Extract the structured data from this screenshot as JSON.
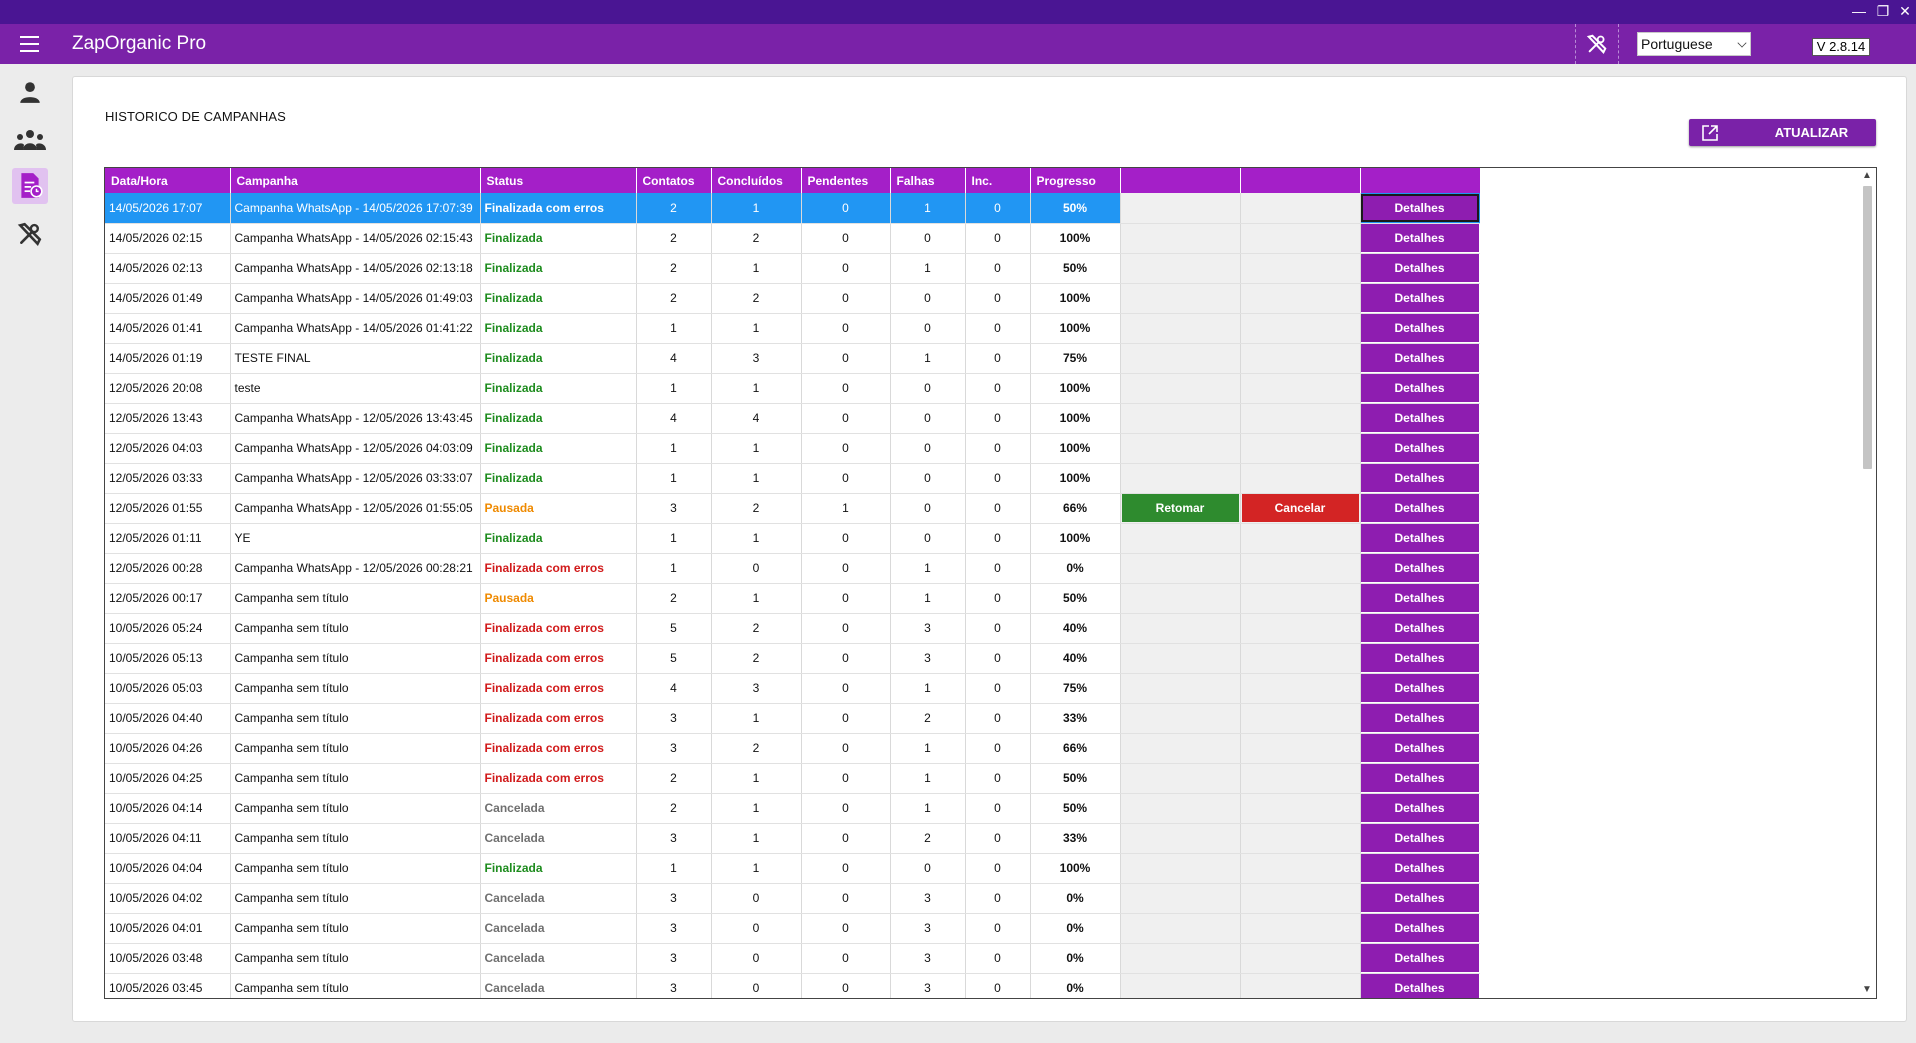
{
  "app": {
    "title": "ZapOrganic Pro",
    "version": "V 2.8.14"
  },
  "window_controls": {
    "minimize": "—",
    "restore": "❐",
    "close": "✕"
  },
  "header": {
    "language": "Portuguese"
  },
  "page": {
    "title": "HISTORICO DE CAMPANHAS",
    "refresh_label": "ATUALIZAR"
  },
  "table": {
    "columns": [
      "Data/Hora",
      "Campanha",
      "Status",
      "Contatos",
      "Concluídos",
      "Pendentes",
      "Falhas",
      "Inc.",
      "Progresso",
      "",
      "",
      ""
    ],
    "details_label": "Detalhes",
    "resume_label": "Retomar",
    "cancel_label": "Cancelar",
    "status_colors": {
      "Finalizada": "#1e8c1e",
      "Finalizada com erros": "#d11a1a",
      "Pausada": "#ef8a00",
      "Cancelada": "#707070"
    },
    "selected_row_color": "#2196f3",
    "rows": [
      {
        "datetime": "14/05/2026 17:07",
        "campaign": "Campanha WhatsApp - 14/05/2026 17:07:39",
        "status": "Finalizada com erros",
        "contacts": "2",
        "done": "1",
        "pending": "0",
        "failed": "1",
        "inc": "0",
        "progress": "50%",
        "selected": true
      },
      {
        "datetime": "14/05/2026 02:15",
        "campaign": "Campanha WhatsApp - 14/05/2026 02:15:43",
        "status": "Finalizada",
        "contacts": "2",
        "done": "2",
        "pending": "0",
        "failed": "0",
        "inc": "0",
        "progress": "100%"
      },
      {
        "datetime": "14/05/2026 02:13",
        "campaign": "Campanha WhatsApp - 14/05/2026 02:13:18",
        "status": "Finalizada",
        "contacts": "2",
        "done": "1",
        "pending": "0",
        "failed": "1",
        "inc": "0",
        "progress": "50%"
      },
      {
        "datetime": "14/05/2026 01:49",
        "campaign": "Campanha WhatsApp - 14/05/2026 01:49:03",
        "status": "Finalizada",
        "contacts": "2",
        "done": "2",
        "pending": "0",
        "failed": "0",
        "inc": "0",
        "progress": "100%"
      },
      {
        "datetime": "14/05/2026 01:41",
        "campaign": "Campanha WhatsApp - 14/05/2026 01:41:22",
        "status": "Finalizada",
        "contacts": "1",
        "done": "1",
        "pending": "0",
        "failed": "0",
        "inc": "0",
        "progress": "100%"
      },
      {
        "datetime": "14/05/2026 01:19",
        "campaign": "TESTE FINAL",
        "status": "Finalizada",
        "contacts": "4",
        "done": "3",
        "pending": "0",
        "failed": "1",
        "inc": "0",
        "progress": "75%"
      },
      {
        "datetime": "12/05/2026 20:08",
        "campaign": "teste",
        "status": "Finalizada",
        "contacts": "1",
        "done": "1",
        "pending": "0",
        "failed": "0",
        "inc": "0",
        "progress": "100%"
      },
      {
        "datetime": "12/05/2026 13:43",
        "campaign": "Campanha WhatsApp - 12/05/2026 13:43:45",
        "status": "Finalizada",
        "contacts": "4",
        "done": "4",
        "pending": "0",
        "failed": "0",
        "inc": "0",
        "progress": "100%"
      },
      {
        "datetime": "12/05/2026 04:03",
        "campaign": "Campanha WhatsApp - 12/05/2026 04:03:09",
        "status": "Finalizada",
        "contacts": "1",
        "done": "1",
        "pending": "0",
        "failed": "0",
        "inc": "0",
        "progress": "100%"
      },
      {
        "datetime": "12/05/2026 03:33",
        "campaign": "Campanha WhatsApp - 12/05/2026 03:33:07",
        "status": "Finalizada",
        "contacts": "1",
        "done": "1",
        "pending": "0",
        "failed": "0",
        "inc": "0",
        "progress": "100%"
      },
      {
        "datetime": "12/05/2026 01:55",
        "campaign": "Campanha WhatsApp - 12/05/2026 01:55:05",
        "status": "Pausada",
        "contacts": "3",
        "done": "2",
        "pending": "1",
        "failed": "0",
        "inc": "0",
        "progress": "66%",
        "actions": true
      },
      {
        "datetime": "12/05/2026 01:11",
        "campaign": "YE",
        "status": "Finalizada",
        "contacts": "1",
        "done": "1",
        "pending": "0",
        "failed": "0",
        "inc": "0",
        "progress": "100%"
      },
      {
        "datetime": "12/05/2026 00:28",
        "campaign": "Campanha WhatsApp - 12/05/2026 00:28:21",
        "status": "Finalizada com erros",
        "contacts": "1",
        "done": "0",
        "pending": "0",
        "failed": "1",
        "inc": "0",
        "progress": "0%"
      },
      {
        "datetime": "12/05/2026 00:17",
        "campaign": "Campanha sem título",
        "status": "Pausada",
        "contacts": "2",
        "done": "1",
        "pending": "0",
        "failed": "1",
        "inc": "0",
        "progress": "50%"
      },
      {
        "datetime": "10/05/2026 05:24",
        "campaign": "Campanha sem título",
        "status": "Finalizada com erros",
        "contacts": "5",
        "done": "2",
        "pending": "0",
        "failed": "3",
        "inc": "0",
        "progress": "40%"
      },
      {
        "datetime": "10/05/2026 05:13",
        "campaign": "Campanha sem título",
        "status": "Finalizada com erros",
        "contacts": "5",
        "done": "2",
        "pending": "0",
        "failed": "3",
        "inc": "0",
        "progress": "40%"
      },
      {
        "datetime": "10/05/2026 05:03",
        "campaign": "Campanha sem título",
        "status": "Finalizada com erros",
        "contacts": "4",
        "done": "3",
        "pending": "0",
        "failed": "1",
        "inc": "0",
        "progress": "75%"
      },
      {
        "datetime": "10/05/2026 04:40",
        "campaign": "Campanha sem título",
        "status": "Finalizada com erros",
        "contacts": "3",
        "done": "1",
        "pending": "0",
        "failed": "2",
        "inc": "0",
        "progress": "33%"
      },
      {
        "datetime": "10/05/2026 04:26",
        "campaign": "Campanha sem título",
        "status": "Finalizada com erros",
        "contacts": "3",
        "done": "2",
        "pending": "0",
        "failed": "1",
        "inc": "0",
        "progress": "66%"
      },
      {
        "datetime": "10/05/2026 04:25",
        "campaign": "Campanha sem título",
        "status": "Finalizada com erros",
        "contacts": "2",
        "done": "1",
        "pending": "0",
        "failed": "1",
        "inc": "0",
        "progress": "50%"
      },
      {
        "datetime": "10/05/2026 04:14",
        "campaign": "Campanha sem título",
        "status": "Cancelada",
        "contacts": "2",
        "done": "1",
        "pending": "0",
        "failed": "1",
        "inc": "0",
        "progress": "50%"
      },
      {
        "datetime": "10/05/2026 04:11",
        "campaign": "Campanha sem título",
        "status": "Cancelada",
        "contacts": "3",
        "done": "1",
        "pending": "0",
        "failed": "2",
        "inc": "0",
        "progress": "33%"
      },
      {
        "datetime": "10/05/2026 04:04",
        "campaign": "Campanha sem título",
        "status": "Finalizada",
        "contacts": "1",
        "done": "1",
        "pending": "0",
        "failed": "0",
        "inc": "0",
        "progress": "100%"
      },
      {
        "datetime": "10/05/2026 04:02",
        "campaign": "Campanha sem título",
        "status": "Cancelada",
        "contacts": "3",
        "done": "0",
        "pending": "0",
        "failed": "3",
        "inc": "0",
        "progress": "0%"
      },
      {
        "datetime": "10/05/2026 04:01",
        "campaign": "Campanha sem título",
        "status": "Cancelada",
        "contacts": "3",
        "done": "0",
        "pending": "0",
        "failed": "3",
        "inc": "0",
        "progress": "0%"
      },
      {
        "datetime": "10/05/2026 03:48",
        "campaign": "Campanha sem título",
        "status": "Cancelada",
        "contacts": "3",
        "done": "0",
        "pending": "0",
        "failed": "3",
        "inc": "0",
        "progress": "0%"
      },
      {
        "datetime": "10/05/2026 03:45",
        "campaign": "Campanha sem título",
        "status": "Cancelada",
        "contacts": "3",
        "done": "0",
        "pending": "0",
        "failed": "3",
        "inc": "0",
        "progress": "0%"
      }
    ]
  }
}
